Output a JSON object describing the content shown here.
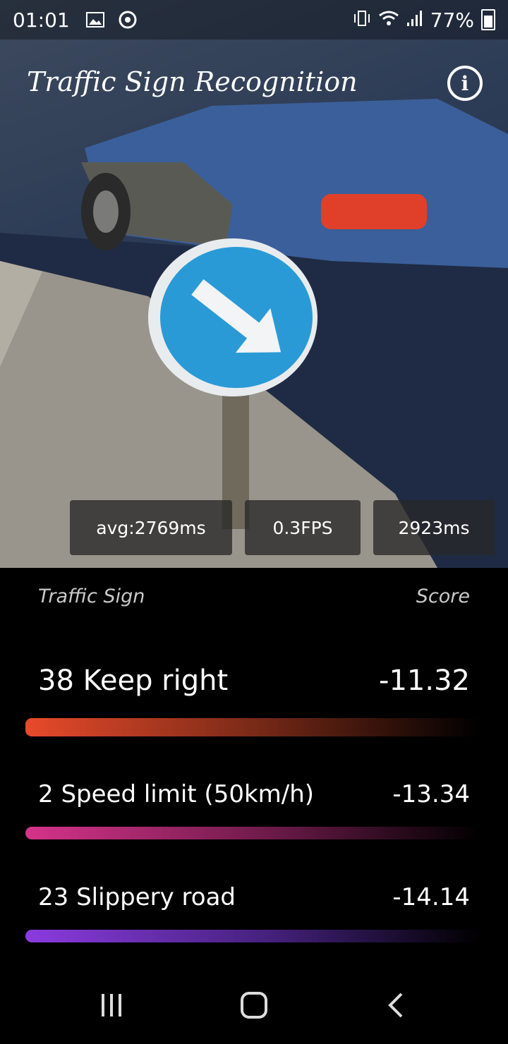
{
  "status_bar": {
    "time": "01:01",
    "battery_percent": "77%",
    "icons": [
      "image-icon",
      "chrome-icon",
      "vibrate-icon",
      "wifi-icon",
      "signal-icon",
      "battery-icon"
    ]
  },
  "app": {
    "title": "Traffic Sign Recognition",
    "info_icon": "info-icon"
  },
  "camera_preview": {
    "stats": {
      "avg": "avg:2769ms",
      "fps": "0.3FPS",
      "latency": "2923ms"
    }
  },
  "results": {
    "column_headers": {
      "sign": "Traffic Sign",
      "score": "Score"
    },
    "items": [
      {
        "label": "38 Keep right",
        "score": "-11.32",
        "bar_color": "#e84a2a"
      },
      {
        "label": "2  Speed limit (50km/h)",
        "score": "-13.34",
        "bar_color": "#d6338a"
      },
      {
        "label": "23  Slippery road",
        "score": "-14.14",
        "bar_color": "#8b3be0"
      }
    ]
  },
  "nav_bar": {
    "icons": [
      "recents-icon",
      "home-icon",
      "back-icon"
    ]
  }
}
